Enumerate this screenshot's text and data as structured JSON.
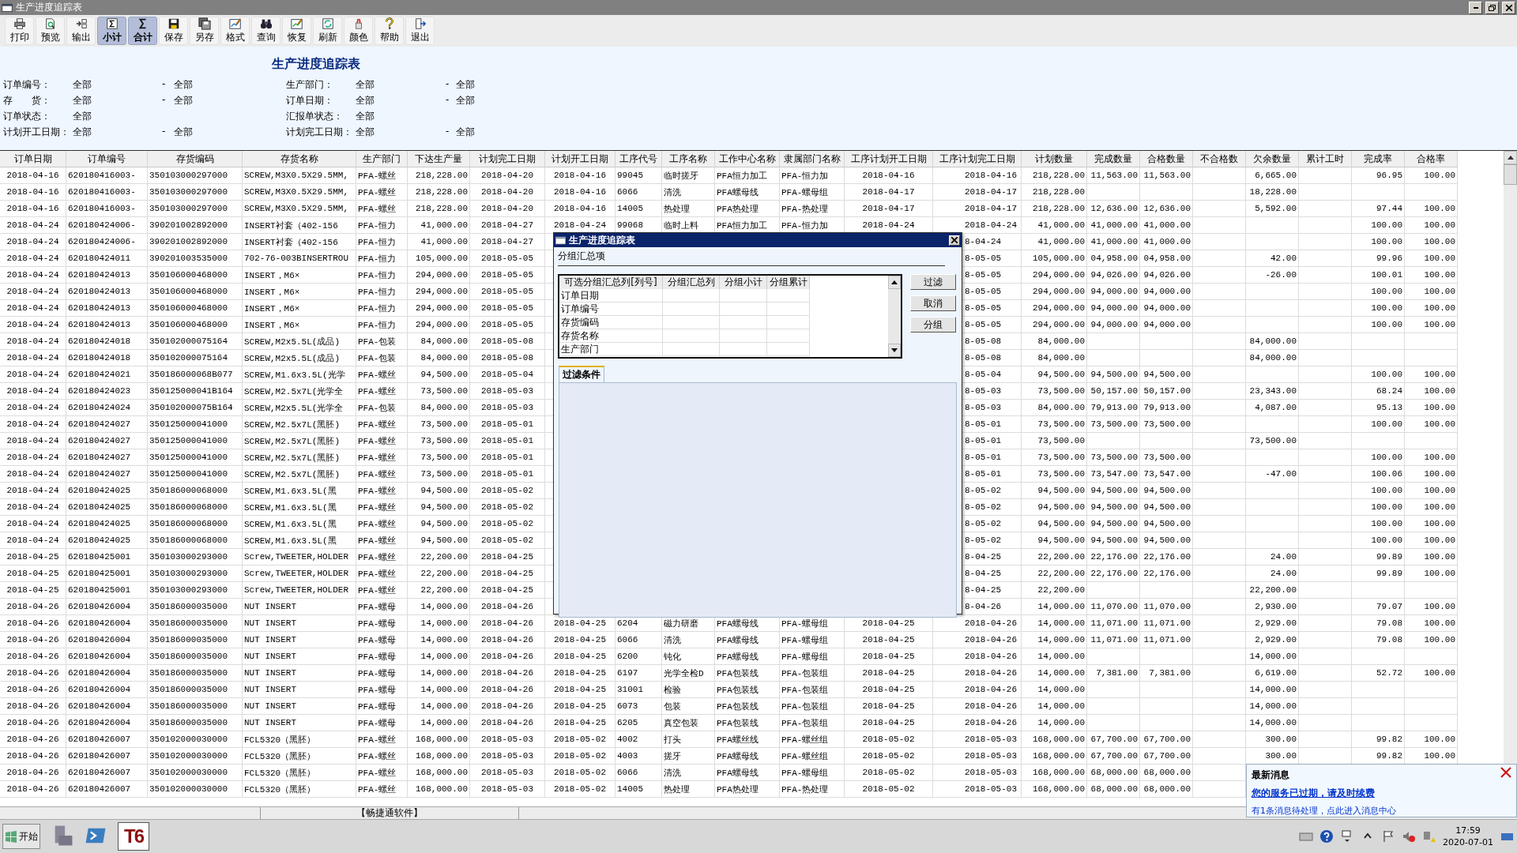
{
  "window": {
    "title": "生产进度追踪表"
  },
  "toolbar": [
    {
      "label": "打印",
      "pressed": false
    },
    {
      "label": "预览",
      "pressed": false
    },
    {
      "label": "输出",
      "pressed": false
    },
    {
      "label": "小计",
      "pressed": true
    },
    {
      "label": "合计",
      "pressed": true
    },
    {
      "label": "保存",
      "pressed": false
    },
    {
      "label": "另存",
      "pressed": false
    },
    {
      "label": "格式",
      "pressed": false
    },
    {
      "label": "查询",
      "pressed": false
    },
    {
      "label": "恢复",
      "pressed": false
    },
    {
      "label": "刷新",
      "pressed": false
    },
    {
      "label": "颜色",
      "pressed": false
    },
    {
      "label": "帮助",
      "pressed": false
    },
    {
      "label": "退出",
      "pressed": false
    }
  ],
  "report": {
    "title": "生产进度追踪表",
    "filters": [
      {
        "label": "订单编号：",
        "from": "全部",
        "sep": "-",
        "to": "全部"
      },
      {
        "label": "生产部门：",
        "from": "全部",
        "sep": "-",
        "to": "全部"
      },
      {
        "label": "存　　货：",
        "from": "全部",
        "sep": "-",
        "to": "全部"
      },
      {
        "label": "订单日期：",
        "from": "全部",
        "sep": "-",
        "to": "全部"
      },
      {
        "label": "订单状态：",
        "from": "全部"
      },
      {
        "label": "汇报单状态：",
        "from": "全部"
      },
      {
        "label": "计划开工日期：",
        "from": "全部",
        "sep": "-",
        "to": "全部"
      },
      {
        "label": "计划完工日期：",
        "from": "全部",
        "sep": "-",
        "to": "全部"
      }
    ]
  },
  "table": {
    "columns": [
      "订单日期",
      "订单编号",
      "存货编码",
      "存货名称",
      "生产部门",
      "下达生产量",
      "计划完工日期",
      "计划开工日期",
      "工序代号",
      "工序名称",
      "工作中心名称",
      "隶属部门名称",
      "工序计划开工日期",
      "工序计划完工日期",
      "计划数量",
      "完成数量",
      "合格数量",
      "不合格数",
      "欠余数量",
      "累计工时",
      "完成率",
      "合格率"
    ],
    "rows": [
      [
        "2018-04-16",
        "620180416003-",
        "350103000297000",
        "SCREW,M3X0.5X29.5MM,",
        "PFA-螺丝",
        "218,228.00",
        "2018-04-20",
        "2018-04-16",
        "99045",
        "临时搓牙",
        "PFA恒力加工",
        "PFA-恒力加",
        "2018-04-16",
        "2018-04-16",
        "218,228.00",
        "11,563.00",
        "11,563.00",
        null,
        "6,665.00",
        null,
        "96.95",
        "100.00"
      ],
      [
        "2018-04-16",
        "620180416003-",
        "350103000297000",
        "SCREW,M3X0.5X29.5MM,",
        "PFA-螺丝",
        "218,228.00",
        "2018-04-20",
        "2018-04-16",
        "6066",
        "清洗",
        "PFA螺母线",
        "PFA-螺母组",
        "2018-04-17",
        "2018-04-17",
        "218,228.00",
        null,
        null,
        null,
        "18,228.00",
        null,
        null,
        null
      ],
      [
        "2018-04-16",
        "620180416003-",
        "350103000297000",
        "SCREW,M3X0.5X29.5MM,",
        "PFA-螺丝",
        "218,228.00",
        "2018-04-20",
        "2018-04-16",
        "14005",
        "热处理",
        "PFA热处理",
        "PFA-热处理",
        "2018-04-17",
        "2018-04-17",
        "218,228.00",
        "12,636.00",
        "12,636.00",
        null,
        "5,592.00",
        null,
        "97.44",
        "100.00"
      ],
      [
        "2018-04-24",
        "620180424006-",
        "390201002892000",
        "INSERT衬套（402-156",
        "PFA-恒力",
        "41,000.00",
        "2018-04-27",
        "2018-04-24",
        "99068",
        "临时上料",
        "PFA恒力加工",
        "PFA-恒力加",
        "2018-04-24",
        "2018-04-24",
        "41,000.00",
        "41,000.00",
        "41,000.00",
        null,
        null,
        null,
        "100.00",
        "100.00"
      ],
      [
        "2018-04-24",
        "620180424006-",
        "390201002892000",
        "INSERT衬套（402-156",
        "PFA-恒力",
        "41,000.00",
        "2018-04-27",
        null,
        null,
        null,
        null,
        null,
        null,
        "8-04-24",
        "41,000.00",
        "41,000.00",
        "41,000.00",
        null,
        null,
        null,
        "100.00",
        "100.00"
      ],
      [
        "2018-04-24",
        "620180424011",
        "390201003535000",
        "702-76-003BINSERTROU",
        "PFA-恒力",
        "105,000.00",
        "2018-05-05",
        null,
        null,
        null,
        null,
        null,
        null,
        "8-05-05",
        "105,000.00",
        "04,958.00",
        "04,958.00",
        null,
        "42.00",
        null,
        "99.96",
        "100.00"
      ],
      [
        "2018-04-24",
        "620180424013",
        "350106000468000",
        "INSERT，M6×",
        "PFA-恒力",
        "294,000.00",
        "2018-05-05",
        null,
        null,
        null,
        null,
        null,
        null,
        "8-05-05",
        "294,000.00",
        "94,026.00",
        "94,026.00",
        null,
        "-26.00",
        null,
        "100.01",
        "100.00"
      ],
      [
        "2018-04-24",
        "620180424013",
        "350106000468000",
        "INSERT，M6×",
        "PFA-恒力",
        "294,000.00",
        "2018-05-05",
        null,
        null,
        null,
        null,
        null,
        null,
        "8-05-05",
        "294,000.00",
        "94,000.00",
        "94,000.00",
        null,
        null,
        null,
        "100.00",
        "100.00"
      ],
      [
        "2018-04-24",
        "620180424013",
        "350106000468000",
        "INSERT，M6×",
        "PFA-恒力",
        "294,000.00",
        "2018-05-05",
        null,
        null,
        null,
        null,
        null,
        null,
        "8-05-05",
        "294,000.00",
        "94,000.00",
        "94,000.00",
        null,
        null,
        null,
        "100.00",
        "100.00"
      ],
      [
        "2018-04-24",
        "620180424013",
        "350106000468000",
        "INSERT，M6×",
        "PFA-恒力",
        "294,000.00",
        "2018-05-05",
        null,
        null,
        null,
        null,
        null,
        null,
        "8-05-05",
        "294,000.00",
        "94,000.00",
        "94,000.00",
        null,
        null,
        null,
        "100.00",
        "100.00"
      ],
      [
        "2018-04-24",
        "620180424018",
        "350102000075164",
        "SCREW,M2x5.5L(成品)",
        "PFA-包装",
        "84,000.00",
        "2018-05-08",
        null,
        null,
        null,
        null,
        null,
        null,
        "8-05-08",
        "84,000.00",
        null,
        null,
        null,
        "84,000.00",
        null,
        null,
        null
      ],
      [
        "2018-04-24",
        "620180424018",
        "350102000075164",
        "SCREW,M2x5.5L(成品)",
        "PFA-包装",
        "84,000.00",
        "2018-05-08",
        null,
        null,
        null,
        null,
        null,
        null,
        "8-05-08",
        "84,000.00",
        null,
        null,
        null,
        "84,000.00",
        null,
        null,
        null
      ],
      [
        "2018-04-24",
        "620180424021",
        "350186000068B077",
        "SCREW,M1.6x3.5L(光学",
        "PFA-螺丝",
        "94,500.00",
        "2018-05-04",
        null,
        null,
        null,
        null,
        null,
        null,
        "8-05-04",
        "94,500.00",
        "94,500.00",
        "94,500.00",
        null,
        null,
        null,
        "100.00",
        "100.00"
      ],
      [
        "2018-04-24",
        "620180424023",
        "350125000041B164",
        "SCREW,M2.5x7L(光学全",
        "PFA-螺丝",
        "73,500.00",
        "2018-05-03",
        null,
        null,
        null,
        null,
        null,
        null,
        "8-05-03",
        "73,500.00",
        "50,157.00",
        "50,157.00",
        null,
        "23,343.00",
        null,
        "68.24",
        "100.00"
      ],
      [
        "2018-04-24",
        "620180424024",
        "350102000075B164",
        "SCREW,M2x5.5L(光学全",
        "PFA-包装",
        "84,000.00",
        "2018-05-03",
        null,
        null,
        null,
        null,
        null,
        null,
        "8-05-03",
        "84,000.00",
        "79,913.00",
        "79,913.00",
        null,
        "4,087.00",
        null,
        "95.13",
        "100.00"
      ],
      [
        "2018-04-24",
        "620180424027",
        "350125000041000",
        "SCREW,M2.5x7L(黑胚)",
        "PFA-螺丝",
        "73,500.00",
        "2018-05-01",
        null,
        null,
        null,
        null,
        null,
        null,
        "8-05-01",
        "73,500.00",
        "73,500.00",
        "73,500.00",
        null,
        null,
        null,
        "100.00",
        "100.00"
      ],
      [
        "2018-04-24",
        "620180424027",
        "350125000041000",
        "SCREW,M2.5x7L(黑胚)",
        "PFA-螺丝",
        "73,500.00",
        "2018-05-01",
        null,
        null,
        null,
        null,
        null,
        null,
        "8-05-01",
        "73,500.00",
        null,
        null,
        null,
        "73,500.00",
        null,
        null,
        null
      ],
      [
        "2018-04-24",
        "620180424027",
        "350125000041000",
        "SCREW,M2.5x7L(黑胚)",
        "PFA-螺丝",
        "73,500.00",
        "2018-05-01",
        null,
        null,
        null,
        null,
        null,
        null,
        "8-05-01",
        "73,500.00",
        "73,500.00",
        "73,500.00",
        null,
        null,
        null,
        "100.00",
        "100.00"
      ],
      [
        "2018-04-24",
        "620180424027",
        "350125000041000",
        "SCREW,M2.5x7L(黑胚)",
        "PFA-螺丝",
        "73,500.00",
        "2018-05-01",
        null,
        null,
        null,
        null,
        null,
        null,
        "8-05-01",
        "73,500.00",
        "73,547.00",
        "73,547.00",
        null,
        "-47.00",
        null,
        "100.06",
        "100.00"
      ],
      [
        "2018-04-24",
        "620180424025",
        "350186000068000",
        "SCREW,M1.6x3.5L(黑",
        "PFA-螺丝",
        "94,500.00",
        "2018-05-02",
        null,
        null,
        null,
        null,
        null,
        null,
        "8-05-02",
        "94,500.00",
        "94,500.00",
        "94,500.00",
        null,
        null,
        null,
        "100.00",
        "100.00"
      ],
      [
        "2018-04-24",
        "620180424025",
        "350186000068000",
        "SCREW,M1.6x3.5L(黑",
        "PFA-螺丝",
        "94,500.00",
        "2018-05-02",
        null,
        null,
        null,
        null,
        null,
        null,
        "8-05-02",
        "94,500.00",
        "94,500.00",
        "94,500.00",
        null,
        null,
        null,
        "100.00",
        "100.00"
      ],
      [
        "2018-04-24",
        "620180424025",
        "350186000068000",
        "SCREW,M1.6x3.5L(黑",
        "PFA-螺丝",
        "94,500.00",
        "2018-05-02",
        null,
        null,
        null,
        null,
        null,
        null,
        "8-05-02",
        "94,500.00",
        "94,500.00",
        "94,500.00",
        null,
        null,
        null,
        "100.00",
        "100.00"
      ],
      [
        "2018-04-24",
        "620180424025",
        "350186000068000",
        "SCREW,M1.6x3.5L(黑",
        "PFA-螺丝",
        "94,500.00",
        "2018-05-02",
        null,
        null,
        null,
        null,
        null,
        null,
        "8-05-02",
        "94,500.00",
        "94,500.00",
        "94,500.00",
        null,
        null,
        null,
        "100.00",
        "100.00"
      ],
      [
        "2018-04-25",
        "620180425001",
        "350103000293000",
        "Screw,TWEETER,HOLDER",
        "PFA-螺丝",
        "22,200.00",
        "2018-04-25",
        null,
        null,
        null,
        null,
        null,
        null,
        "8-04-25",
        "22,200.00",
        "22,176.00",
        "22,176.00",
        null,
        "24.00",
        null,
        "99.89",
        "100.00"
      ],
      [
        "2018-04-25",
        "620180425001",
        "350103000293000",
        "Screw,TWEETER,HOLDER",
        "PFA-螺丝",
        "22,200.00",
        "2018-04-25",
        null,
        null,
        null,
        null,
        null,
        null,
        "8-04-25",
        "22,200.00",
        "22,176.00",
        "22,176.00",
        null,
        "24.00",
        null,
        "99.89",
        "100.00"
      ],
      [
        "2018-04-25",
        "620180425001",
        "350103000293000",
        "Screw,TWEETER,HOLDER",
        "PFA-螺丝",
        "22,200.00",
        "2018-04-25",
        null,
        null,
        null,
        null,
        null,
        null,
        "8-04-25",
        "22,200.00",
        null,
        null,
        null,
        "22,200.00",
        null,
        null,
        null
      ],
      [
        "2018-04-26",
        "620180426004",
        "350186000035000",
        "NUT INSERT",
        "PFA-螺母",
        "14,000.00",
        "2018-04-26",
        null,
        null,
        null,
        null,
        null,
        null,
        "8-04-26",
        "14,000.00",
        "11,070.00",
        "11,070.00",
        null,
        "2,930.00",
        null,
        "79.07",
        "100.00"
      ],
      [
        "2018-04-26",
        "620180426004",
        "350186000035000",
        "NUT INSERT",
        "PFA-螺母",
        "14,000.00",
        "2018-04-26",
        "2018-04-25",
        "6204",
        "磁力研磨",
        "PFA螺母线",
        "PFA-螺母组",
        "2018-04-25",
        "2018-04-26",
        "14,000.00",
        "11,071.00",
        "11,071.00",
        null,
        "2,929.00",
        null,
        "79.08",
        "100.00"
      ],
      [
        "2018-04-26",
        "620180426004",
        "350186000035000",
        "NUT INSERT",
        "PFA-螺母",
        "14,000.00",
        "2018-04-26",
        "2018-04-25",
        "6066",
        "清洗",
        "PFA螺母线",
        "PFA-螺母组",
        "2018-04-25",
        "2018-04-26",
        "14,000.00",
        "11,071.00",
        "11,071.00",
        null,
        "2,929.00",
        null,
        "79.08",
        "100.00"
      ],
      [
        "2018-04-26",
        "620180426004",
        "350186000035000",
        "NUT INSERT",
        "PFA-螺母",
        "14,000.00",
        "2018-04-26",
        "2018-04-25",
        "6200",
        "钝化",
        "PFA螺母线",
        "PFA-螺母组",
        "2018-04-25",
        "2018-04-26",
        "14,000.00",
        null,
        null,
        null,
        "14,000.00",
        null,
        null,
        null
      ],
      [
        "2018-04-26",
        "620180426004",
        "350186000035000",
        "NUT INSERT",
        "PFA-螺母",
        "14,000.00",
        "2018-04-26",
        "2018-04-25",
        "6197",
        "光学全检D",
        "PFA包装线",
        "PFA-包装组",
        "2018-04-25",
        "2018-04-26",
        "14,000.00",
        "7,381.00",
        "7,381.00",
        null,
        "6,619.00",
        null,
        "52.72",
        "100.00"
      ],
      [
        "2018-04-26",
        "620180426004",
        "350186000035000",
        "NUT INSERT",
        "PFA-螺母",
        "14,000.00",
        "2018-04-26",
        "2018-04-25",
        "31001",
        "检验",
        "PFA包装线",
        "PFA-包装组",
        "2018-04-25",
        "2018-04-26",
        "14,000.00",
        null,
        null,
        null,
        "14,000.00",
        null,
        null,
        null
      ],
      [
        "2018-04-26",
        "620180426004",
        "350186000035000",
        "NUT INSERT",
        "PFA-螺母",
        "14,000.00",
        "2018-04-26",
        "2018-04-25",
        "6073",
        "包装",
        "PFA包装线",
        "PFA-包装组",
        "2018-04-25",
        "2018-04-26",
        "14,000.00",
        null,
        null,
        null,
        "14,000.00",
        null,
        null,
        null
      ],
      [
        "2018-04-26",
        "620180426004",
        "350186000035000",
        "NUT INSERT",
        "PFA-螺母",
        "14,000.00",
        "2018-04-26",
        "2018-04-25",
        "6205",
        "真空包装",
        "PFA包装线",
        "PFA-包装组",
        "2018-04-25",
        "2018-04-26",
        "14,000.00",
        null,
        null,
        null,
        "14,000.00",
        null,
        null,
        null
      ],
      [
        "2018-04-26",
        "620180426007",
        "350102000030000",
        "FCL5320（黑胚）",
        "PFA-螺丝",
        "168,000.00",
        "2018-05-03",
        "2018-05-02",
        "4002",
        "打头",
        "PFA螺丝线",
        "PFA-螺丝组",
        "2018-05-02",
        "2018-05-03",
        "168,000.00",
        "67,700.00",
        "67,700.00",
        null,
        "300.00",
        null,
        "99.82",
        "100.00"
      ],
      [
        "2018-04-26",
        "620180426007",
        "350102000030000",
        "FCL5320（黑胚）",
        "PFA-螺丝",
        "168,000.00",
        "2018-05-03",
        "2018-05-02",
        "4003",
        "搓牙",
        "PFA螺母线",
        "PFA-螺丝组",
        "2018-05-02",
        "2018-05-03",
        "168,000.00",
        "67,700.00",
        "67,700.00",
        null,
        "300.00",
        null,
        "99.82",
        "100.00"
      ],
      [
        "2018-04-26",
        "620180426007",
        "350102000030000",
        "FCL5320（黑胚）",
        "PFA-螺丝",
        "168,000.00",
        "2018-05-03",
        "2018-05-02",
        "6066",
        "清洗",
        "PFA螺母线",
        "PFA-螺母组",
        "2018-05-02",
        "2018-05-03",
        "168,000.00",
        "68,000.00",
        "68,000.00",
        null,
        null,
        null,
        null,
        null
      ],
      [
        "2018-04-26",
        "620180426007",
        "350102000030000",
        "FCL5320（黑胚）",
        "PFA-螺丝",
        "168,000.00",
        "2018-05-03",
        "2018-05-02",
        "14005",
        "热处理",
        "PFA热处理",
        "PFA-热处理",
        "2018-05-02",
        "2018-05-03",
        "168,000.00",
        "68,000.00",
        "68,000.00",
        null,
        null,
        null,
        null,
        null
      ]
    ]
  },
  "dialog": {
    "title": "生产进度追踪表",
    "section": "分组汇总项",
    "grid": {
      "columns": [
        "可选分组汇总列[列号]",
        "分组汇总列",
        "分组小计",
        "分组累计"
      ],
      "rows": [
        "订单日期",
        "订单编号",
        "存货编码",
        "存货名称",
        "生产部门"
      ]
    },
    "buttons": [
      "过滤",
      "取消",
      "分组"
    ],
    "tabs": [
      {
        "label": "过滤条件",
        "selected": true
      }
    ]
  },
  "status_bar": {
    "text": "【畅捷通软件】"
  },
  "notification": {
    "title": "最新消息",
    "link": "您的服务已过期，请及时续费",
    "message": "有1条消息待处理，点此进入消息中心"
  },
  "taskbar": {
    "start": "开始",
    "app": "T6",
    "time": "17:59",
    "date": "2020-07-01"
  }
}
